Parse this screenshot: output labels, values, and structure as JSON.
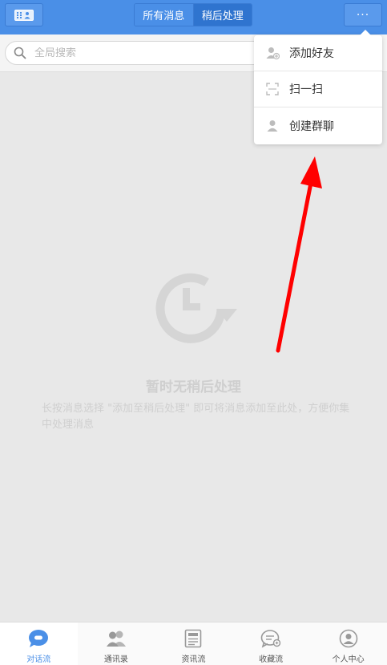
{
  "header": {
    "tabs": [
      {
        "label": "所有消息",
        "selected": false
      },
      {
        "label": "稍后处理",
        "selected": true
      }
    ],
    "more_label": "···"
  },
  "search": {
    "placeholder": "全局搜索",
    "value": ""
  },
  "empty_state": {
    "title": "暂时无稍后处理",
    "description": "长按消息选择 \"添加至稍后处理\" 即可将消息添加至此处，方便你集中处理消息"
  },
  "menu": {
    "items": [
      {
        "label": "添加好友",
        "icon": "add-user-icon"
      },
      {
        "label": "扫一扫",
        "icon": "scan-icon"
      },
      {
        "label": "创建群聊",
        "icon": "group-icon"
      }
    ]
  },
  "bottom_nav": {
    "items": [
      {
        "label": "对话流",
        "icon": "chat-icon",
        "active": true
      },
      {
        "label": "通讯录",
        "icon": "contacts-icon",
        "active": false
      },
      {
        "label": "资讯流",
        "icon": "news-icon",
        "active": false
      },
      {
        "label": "收藏流",
        "icon": "favorites-icon",
        "active": false
      },
      {
        "label": "个人中心",
        "icon": "profile-icon",
        "active": false
      }
    ]
  },
  "colors": {
    "accent": "#4a8fe7",
    "annotation_arrow": "#ff0000"
  }
}
